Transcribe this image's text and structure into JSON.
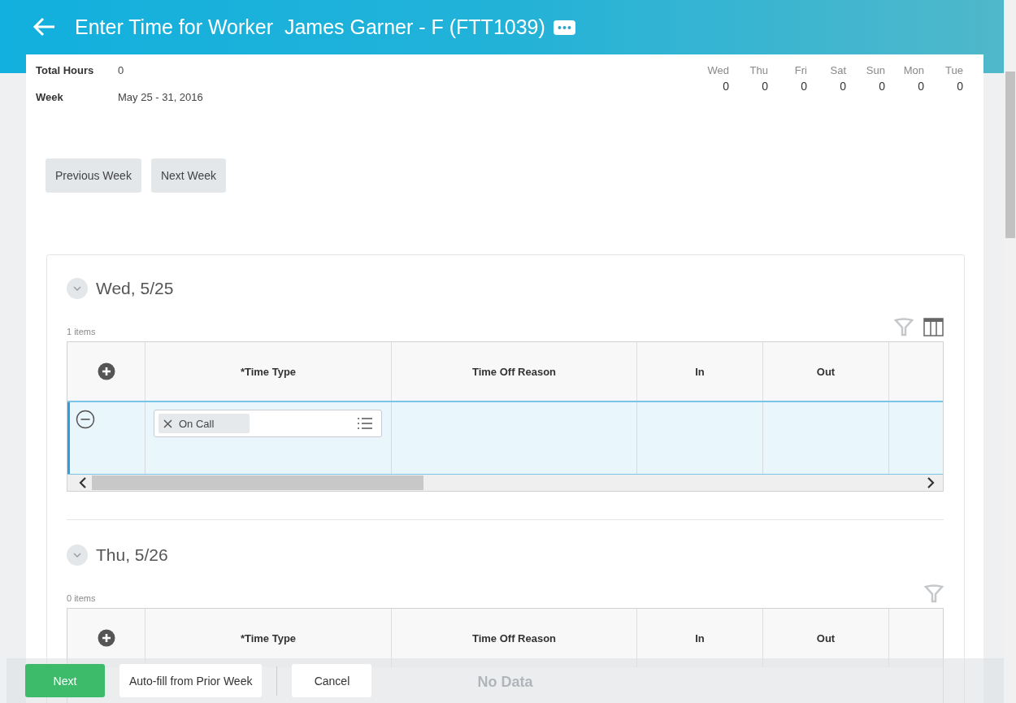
{
  "header": {
    "title": "Enter Time for Worker  James Garner - F (FTT1039)"
  },
  "summary": {
    "total_hours_label": "Total Hours",
    "total_hours": "0",
    "week_label": "Week",
    "week": "May 25 - 31, 2016"
  },
  "days": [
    {
      "day": "Wed",
      "hours": "0"
    },
    {
      "day": "Thu",
      "hours": "0"
    },
    {
      "day": "Fri",
      "hours": "0"
    },
    {
      "day": "Sat",
      "hours": "0"
    },
    {
      "day": "Sun",
      "hours": "0"
    },
    {
      "day": "Mon",
      "hours": "0"
    },
    {
      "day": "Tue",
      "hours": "0"
    }
  ],
  "week_buttons": [
    "Previous Week",
    "Next Week"
  ],
  "sections": [
    {
      "title": "Wed, 5/25",
      "count": "1 items",
      "columns_button": true,
      "columns": [
        "*Time Type",
        "Time Off Reason",
        "In",
        "Out"
      ],
      "rows": [
        {
          "time_type": "On Call",
          "selected": true
        }
      ]
    },
    {
      "title": "Thu, 5/26",
      "count": "0 items",
      "columns_button": false,
      "columns": [
        "*Time Type",
        "Time Off Reason",
        "In",
        "Out"
      ],
      "empty_text": "No Data"
    }
  ],
  "footer": {
    "buttons": [
      {
        "label": "Next",
        "kind": "primary"
      },
      {
        "label": "Auto-fill from Prior Week",
        "kind": "secondary"
      },
      {
        "label": "Cancel",
        "kind": "secondary"
      }
    ]
  }
}
